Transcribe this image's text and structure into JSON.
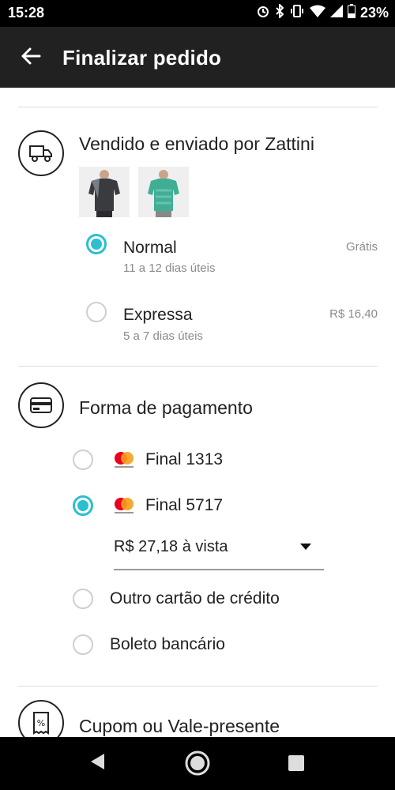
{
  "status_bar": {
    "time": "15:28",
    "battery": "23%",
    "icons": [
      "alarm-icon",
      "bluetooth-icon",
      "vibrate-icon",
      "wifi-icon",
      "signal-icon",
      "battery-icon"
    ]
  },
  "app_bar": {
    "title": "Finalizar pedido",
    "back_icon": "arrow-left-icon"
  },
  "shipping": {
    "title": "Vendido e enviado por Zattini",
    "icon": "truck-icon",
    "products": [
      {
        "name": "gray-shirt",
        "colors": [
          "#3a3b3f",
          "#7b7d84"
        ]
      },
      {
        "name": "teal-shirt",
        "colors": [
          "#3fae95",
          "#66c3ad"
        ]
      }
    ],
    "options": [
      {
        "label": "Normal",
        "sub": "11 a 12 dias úteis",
        "price": "Grátis",
        "selected": true
      },
      {
        "label": "Expressa",
        "sub": "5 a 7 dias úteis",
        "price": "R$ 16,40",
        "selected": false
      }
    ]
  },
  "payment": {
    "title": "Forma de pagamento",
    "icon": "credit-card-icon",
    "cards": [
      {
        "label": "Final 1313",
        "brand": "mastercard",
        "selected": false
      },
      {
        "label": "Final 5717",
        "brand": "mastercard",
        "selected": true
      }
    ],
    "installment_select": {
      "value": "R$ 27,18 à vista"
    },
    "other_options": [
      {
        "label": "Outro cartão de crédito",
        "selected": false
      },
      {
        "label": "Boleto bancário",
        "selected": false
      }
    ]
  },
  "coupon": {
    "title": "Cupom ou Vale-presente",
    "icon": "discount-receipt-icon"
  },
  "colors": {
    "accent": "#2bbfcf",
    "app_bar": "#212121",
    "status_bar": "#000000"
  }
}
